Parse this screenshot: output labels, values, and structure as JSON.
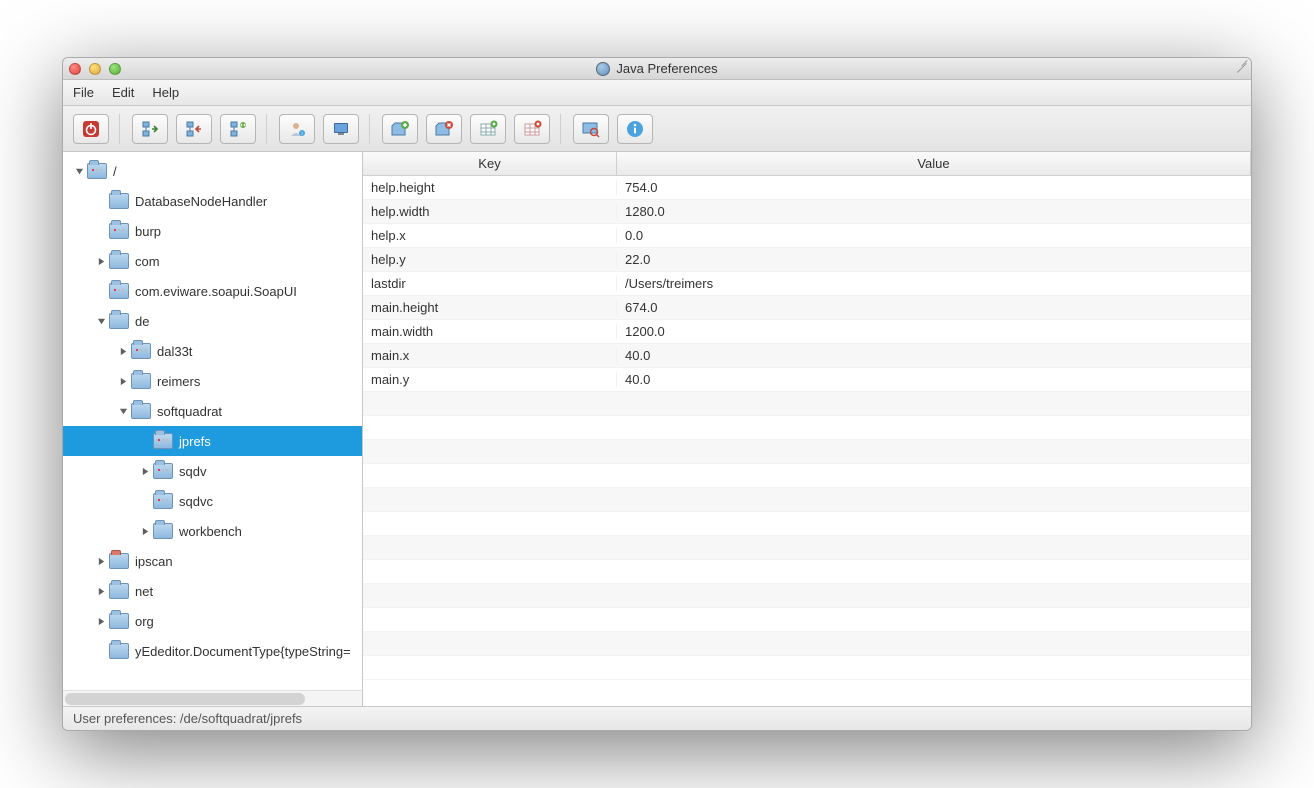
{
  "window": {
    "title": "Java Preferences"
  },
  "menu": {
    "file": "File",
    "edit": "Edit",
    "help": "Help"
  },
  "tree": {
    "items": [
      {
        "label": "/",
        "indent": 0,
        "arrow": "down",
        "dotted": true
      },
      {
        "label": "DatabaseNodeHandler",
        "indent": 1,
        "arrow": "none"
      },
      {
        "label": "burp",
        "indent": 1,
        "arrow": "none",
        "dotted": true
      },
      {
        "label": "com",
        "indent": 1,
        "arrow": "right"
      },
      {
        "label": "com.eviware.soapui.SoapUI",
        "indent": 1,
        "arrow": "none",
        "dotted": true
      },
      {
        "label": "de",
        "indent": 1,
        "arrow": "down"
      },
      {
        "label": "dal33t",
        "indent": 2,
        "arrow": "right",
        "dotted": true
      },
      {
        "label": "reimers",
        "indent": 2,
        "arrow": "right"
      },
      {
        "label": "softquadrat",
        "indent": 2,
        "arrow": "down"
      },
      {
        "label": "jprefs",
        "indent": 3,
        "arrow": "none",
        "selected": true,
        "dotted": true
      },
      {
        "label": "sqdv",
        "indent": 3,
        "arrow": "right",
        "dotted": true
      },
      {
        "label": "sqdvc",
        "indent": 3,
        "arrow": "none",
        "dotted": true
      },
      {
        "label": "workbench",
        "indent": 3,
        "arrow": "right"
      },
      {
        "label": "ipscan",
        "indent": 1,
        "arrow": "right",
        "redtab": true
      },
      {
        "label": "net",
        "indent": 1,
        "arrow": "right"
      },
      {
        "label": "org",
        "indent": 1,
        "arrow": "right"
      },
      {
        "label": "yEdeditor.DocumentType{typeString=",
        "indent": 1,
        "arrow": "none"
      }
    ]
  },
  "table": {
    "headers": {
      "key": "Key",
      "value": "Value"
    },
    "rows": [
      {
        "k": "help.height",
        "v": "754.0"
      },
      {
        "k": "help.width",
        "v": "1280.0"
      },
      {
        "k": "help.x",
        "v": "0.0"
      },
      {
        "k": "help.y",
        "v": "22.0"
      },
      {
        "k": "lastdir",
        "v": "/Users/treimers"
      },
      {
        "k": "main.height",
        "v": "674.0"
      },
      {
        "k": "main.width",
        "v": "1200.0"
      },
      {
        "k": "main.x",
        "v": "40.0"
      },
      {
        "k": "main.y",
        "v": "40.0"
      }
    ],
    "emptyRows": 12
  },
  "status": {
    "text": "User preferences: /de/softquadrat/jprefs"
  }
}
